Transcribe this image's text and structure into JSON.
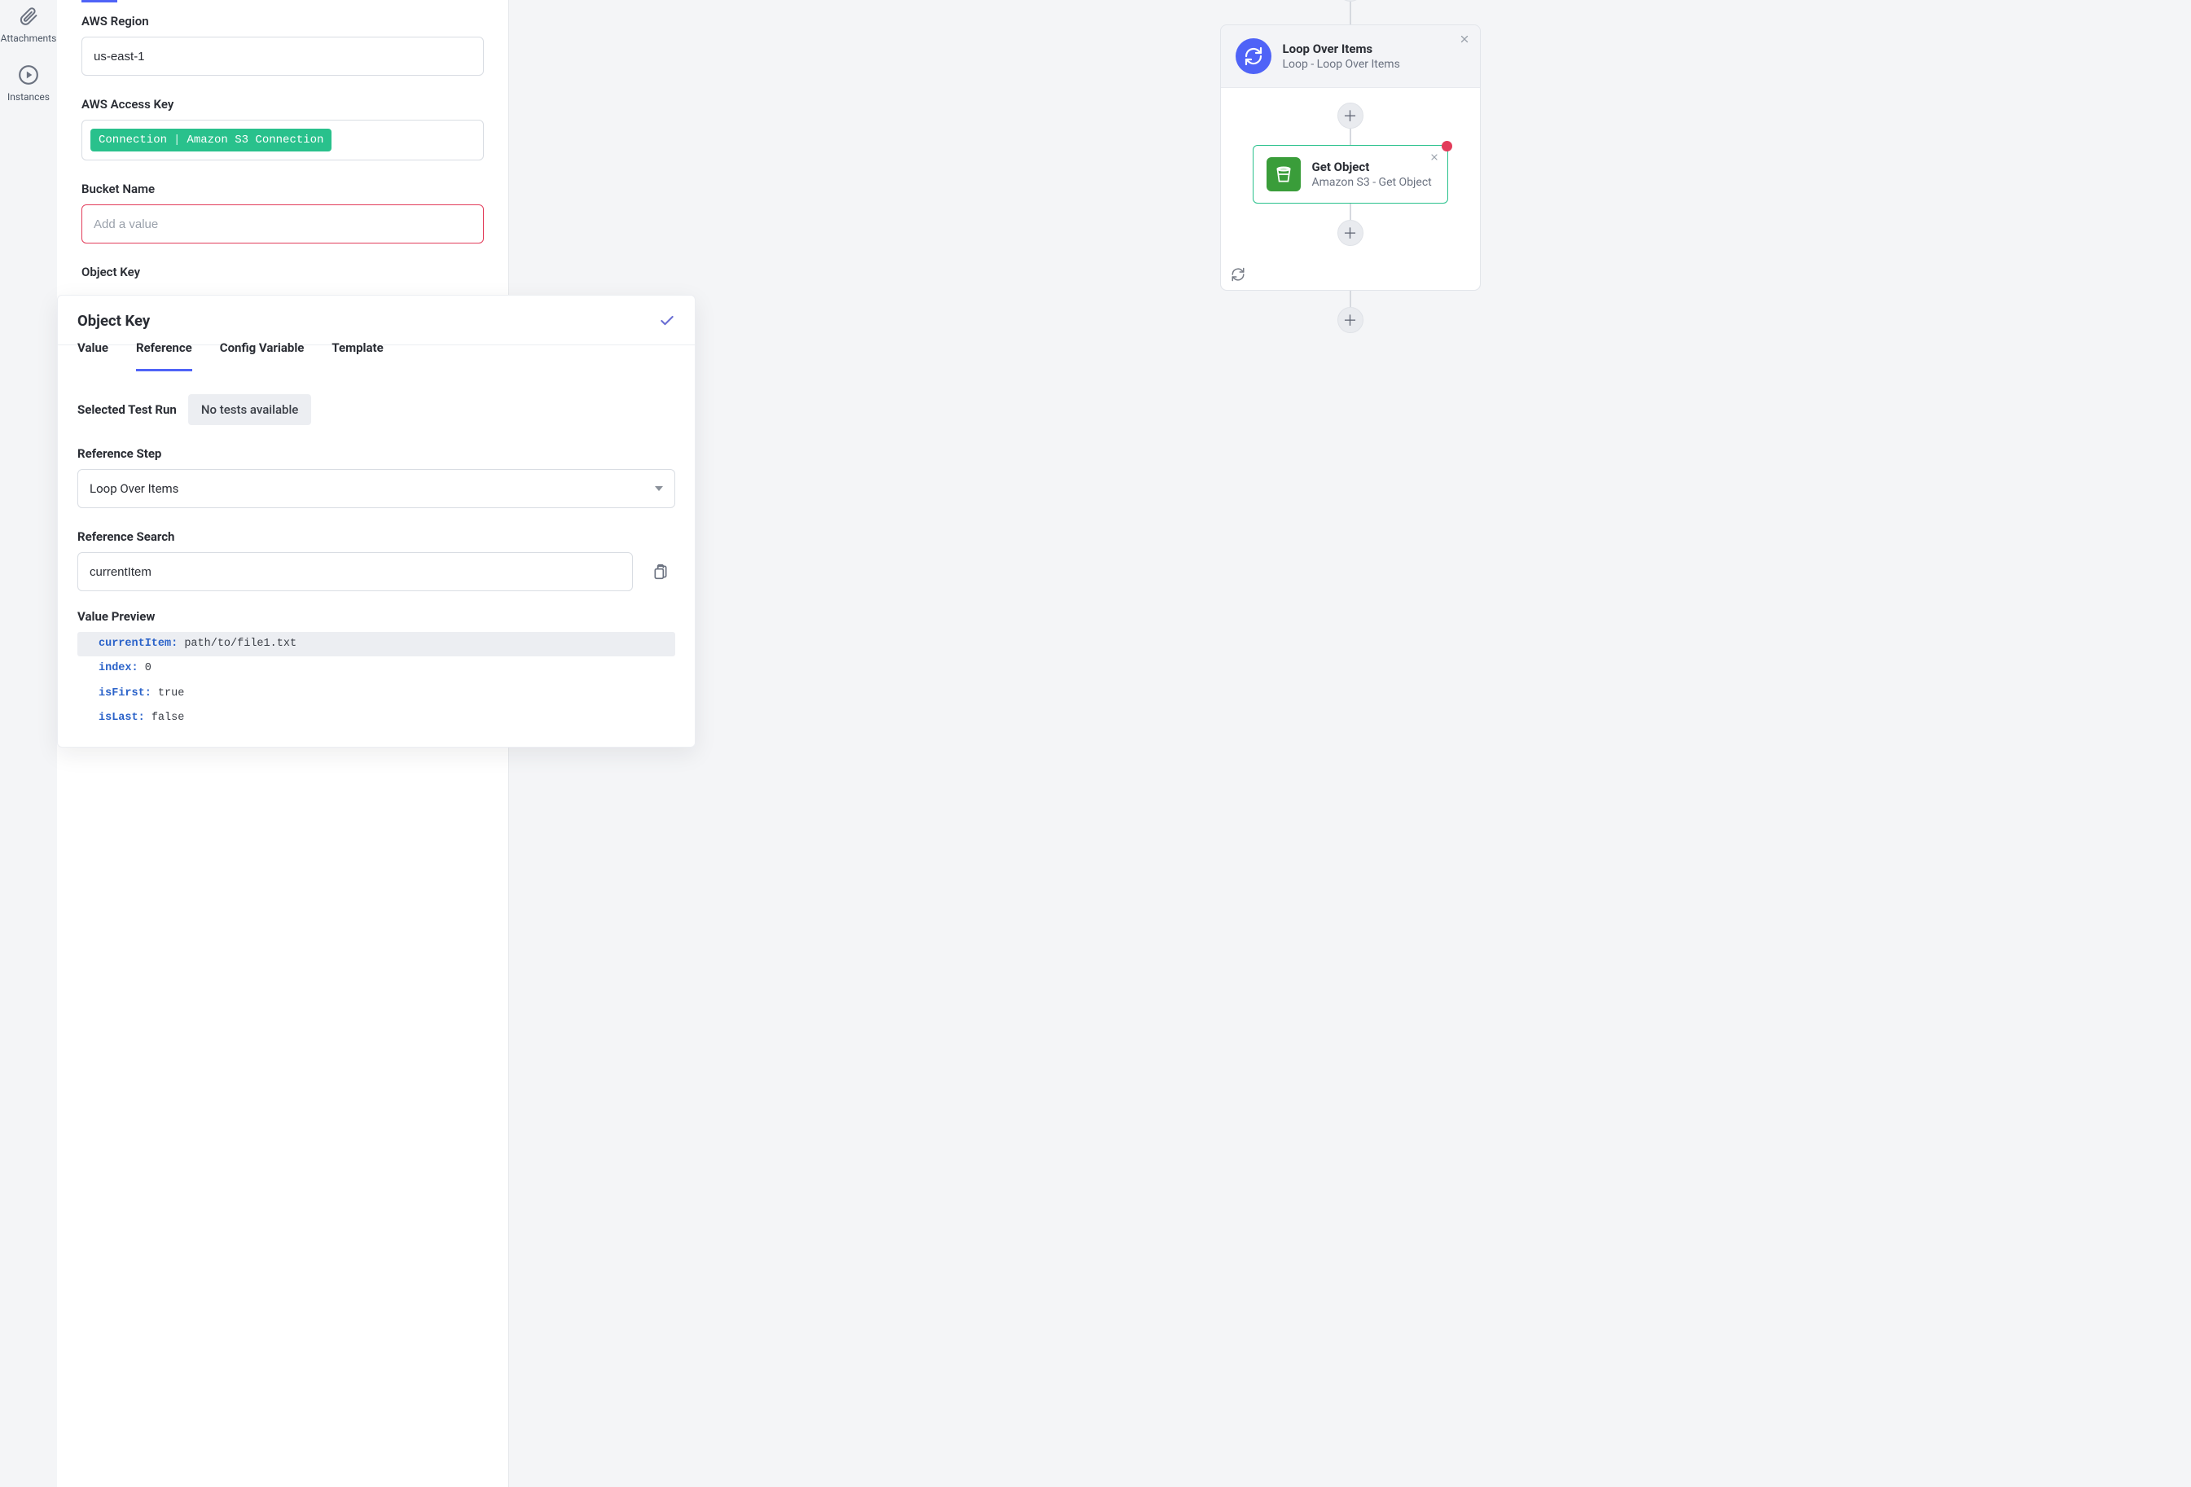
{
  "leftnav": {
    "attachments": "Attachments",
    "instances": "Instances"
  },
  "form": {
    "aws_region_label": "AWS Region",
    "aws_region_value": "us-east-1",
    "aws_access_key_label": "AWS Access Key",
    "connection_chip_prefix": "Connection",
    "connection_chip_name": "Amazon S3 Connection",
    "bucket_name_label": "Bucket Name",
    "bucket_name_placeholder": "Add a value",
    "object_key_label": "Object Key"
  },
  "popover": {
    "title": "Object Key",
    "tabs": [
      "Value",
      "Reference",
      "Config Variable",
      "Template"
    ],
    "active_tab": "Reference",
    "selected_test_run_label": "Selected Test Run",
    "no_tests": "No tests available",
    "reference_step_label": "Reference Step",
    "reference_step_value": "Loop Over Items",
    "reference_search_label": "Reference Search",
    "reference_search_value": "currentItem",
    "value_preview_label": "Value Preview",
    "preview": [
      {
        "key": "currentItem:",
        "val": " path/to/file1.txt",
        "hl": true
      },
      {
        "key": "index:",
        "val": " 0",
        "hl": false
      },
      {
        "key": "isFirst:",
        "val": " true",
        "hl": false
      },
      {
        "key": "isLast:",
        "val": " false",
        "hl": false
      }
    ]
  },
  "flow": {
    "loop": {
      "title": "Loop Over Items",
      "subtitle": "Loop - Loop Over Items"
    },
    "get_object": {
      "title": "Get Object",
      "subtitle": "Amazon S3 - Get Object"
    }
  }
}
